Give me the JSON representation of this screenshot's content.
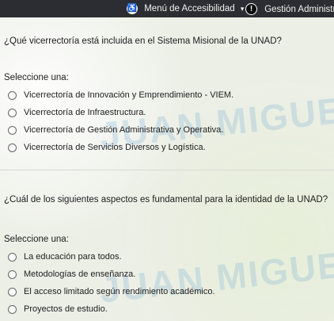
{
  "topbar": {
    "accessibility_label": "Menú de Accesibilidad",
    "admin_label": "Gestión Administrativ"
  },
  "watermark": "JUAN MIGUEL BOL",
  "question1": {
    "text": "¿Qué vicerrectoría está incluida en el Sistema Misional de la UNAD?",
    "prompt": "Seleccione una:",
    "options": [
      "Vicerrectoría de Innovación y Emprendimiento - VIEM.",
      "Vicerrectoría de Infraestructura.",
      "Vicerrectoría de Gestión Administrativa y Operativa.",
      "Vicerrectoría de Servicios Diversos y Logística."
    ]
  },
  "question2": {
    "text": "¿Cuál de los siguientes aspectos es fundamental para la identidad de la UNAD?",
    "prompt": "Seleccione una:",
    "options": [
      "La educación para todos.",
      "Metodologías de enseñanza.",
      "El acceso limitado según rendimiento académico.",
      "Proyectos de estudio."
    ]
  }
}
